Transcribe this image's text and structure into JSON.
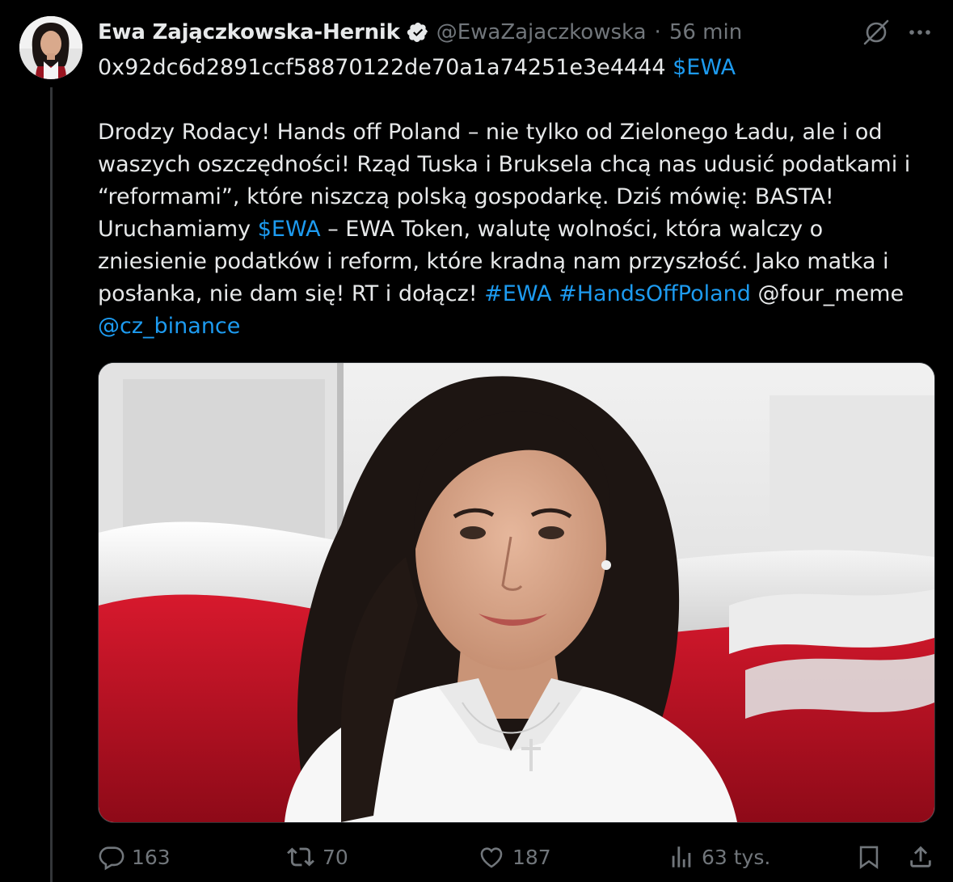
{
  "author": {
    "name": "Ewa Zajączkowska-Hernik",
    "handle": "@EwaZajaczkowska",
    "separator": "·",
    "time": "56 min"
  },
  "tweet": {
    "contract_address": "0x92dc6d2891ccf58870122de70a1a74251e3e4444",
    "cashtag": "$EWA",
    "line1": "Drodzy Rodacy! Hands off Poland – nie tylko od Zielonego Ładu, ale i od",
    "line2": "waszych oszczędności! Rząd Tuska i Bruksela chcą nas udusić podatkami i",
    "line3": "“reformami”, które niszczą polską gospodarkę. Dziś mówię: BASTA!",
    "line4_prefix": "Uruchamiamy ",
    "line4_tag": "$EWA",
    "line4_suffix": " – EWA Token, walutę wolności, która walczy o",
    "line5": "zniesienie podatków i reform, które kradną nam przyszłość. Jako matka i",
    "line6_prefix": "posłanka, nie dam się! RT i dołącz! ",
    "line6_tag1": "#EWA",
    "line6_tag2": "#HandsOffPoland",
    "line6_mention1": "@four_meme",
    "line7_mention": "@cz_binance"
  },
  "stats": {
    "replies": "163",
    "reposts": "70",
    "likes": "187",
    "views": "63 tys."
  },
  "icons": {
    "verified": "verified-badge-icon",
    "grok": "grok-icon",
    "more": "more-icon",
    "reply": "reply-icon",
    "repost": "repost-icon",
    "like": "like-icon",
    "views": "views-icon",
    "bookmark": "bookmark-icon",
    "share": "share-icon"
  },
  "colors": {
    "background": "#000000",
    "text": "#e7e9ea",
    "secondary": "#71767b",
    "link": "#1d9bf0",
    "flag_red": "#c8102e"
  }
}
